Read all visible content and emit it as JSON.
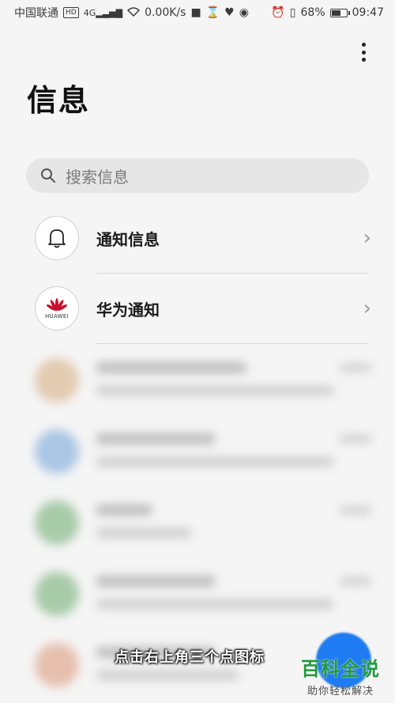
{
  "status_bar": {
    "carrier": "中国联通",
    "hd_badge": "HD",
    "signal_label": "4G",
    "speed": "0.00K/s",
    "battery": "68%",
    "battery_level": 0.68,
    "time": "09:47"
  },
  "header": {
    "title": "信息",
    "more_icon": "more-vertical-icon"
  },
  "search": {
    "placeholder": "搜索信息",
    "icon": "search-icon"
  },
  "pinned": [
    {
      "label": "通知信息",
      "icon": "bell-icon"
    },
    {
      "label": "华为通知",
      "icon": "huawei-logo-icon",
      "logo_text": "HUAWEI"
    }
  ],
  "conversations_blurred": [
    {
      "avatar_color": "#e2cbb1"
    },
    {
      "avatar_color": "#aac6e4"
    },
    {
      "avatar_color": "#a7cba8"
    },
    {
      "avatar_color": "#a7cba8"
    },
    {
      "avatar_color": "#e6bfae"
    }
  ],
  "overlay": {
    "caption": "点击右上角三个点图标",
    "watermark_main": "百科全说",
    "watermark_sub": "助你轻松解决"
  },
  "colors": {
    "accent_fab": "#1e7bf2",
    "watermark": "#1c9a3a"
  }
}
